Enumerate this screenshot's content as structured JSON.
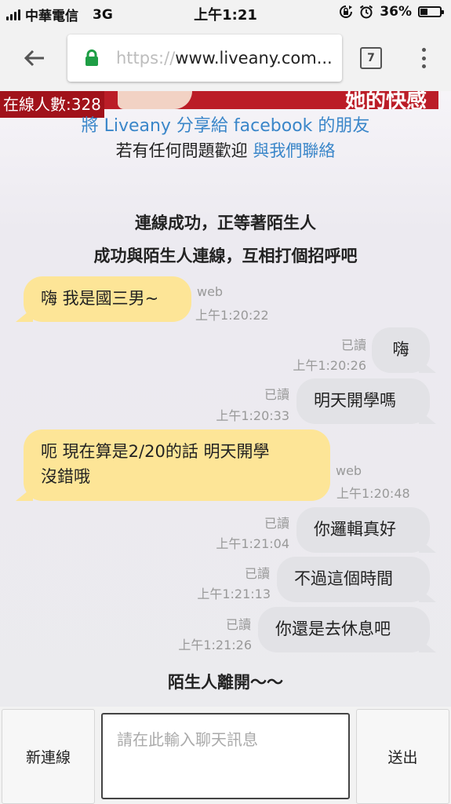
{
  "status_bar": {
    "carrier": "中華電信",
    "network": "3G",
    "time": "上午1:21",
    "battery_text": "36%",
    "battery_level": 0.36,
    "rotation_lock_icon": "rotation-lock-icon",
    "alarm_icon": "alarm-icon"
  },
  "browser": {
    "url_scheme": "https://",
    "url_host": "www.liveany.com...",
    "tab_count": "7",
    "lock_color": "#1e9e45"
  },
  "page": {
    "online_count": "在線人數:328",
    "banner_text": "她的快感",
    "share_text": "將 Liveany 分享給 facebook 的朋友",
    "contact_prefix": "若有任何問題歡迎",
    "contact_link": "與我們聯絡",
    "notice_connected": "連線成功，正等著陌生人",
    "notice_greet": "成功與陌生人連線，互相打個招呼吧",
    "notice_left": "陌生人離開～～"
  },
  "messages": [
    {
      "side": "them",
      "text": "嗨  我是國三男~",
      "source": "web",
      "time": "上午1:20:22"
    },
    {
      "side": "me",
      "text": "嗨",
      "read": "已讀",
      "time": "上午1:20:26"
    },
    {
      "side": "me",
      "text": "明天開學嗎",
      "read": "已讀",
      "time": "上午1:20:33"
    },
    {
      "side": "them",
      "text": "呃  現在算是2/20的話  明天開學\n沒錯哦",
      "source": "web",
      "time": "上午1:20:48"
    },
    {
      "side": "me",
      "text": "你邏輯真好",
      "read": "已讀",
      "time": "上午1:21:04"
    },
    {
      "side": "me",
      "text": "不過這個時間",
      "read": "已讀",
      "time": "上午1:21:13"
    },
    {
      "side": "me",
      "text": "你還是去休息吧",
      "read": "已讀",
      "time": "上午1:21:26"
    }
  ],
  "bottom_bar": {
    "new_connection_label": "新連線",
    "input_placeholder": "請在此輸入聊天訊息",
    "send_label": "送出"
  },
  "colors": {
    "stranger_bubble": "#fde597",
    "my_bubble": "#e2e2e6",
    "link_blue": "#3a86c9",
    "online_badge": "#a1121a"
  }
}
